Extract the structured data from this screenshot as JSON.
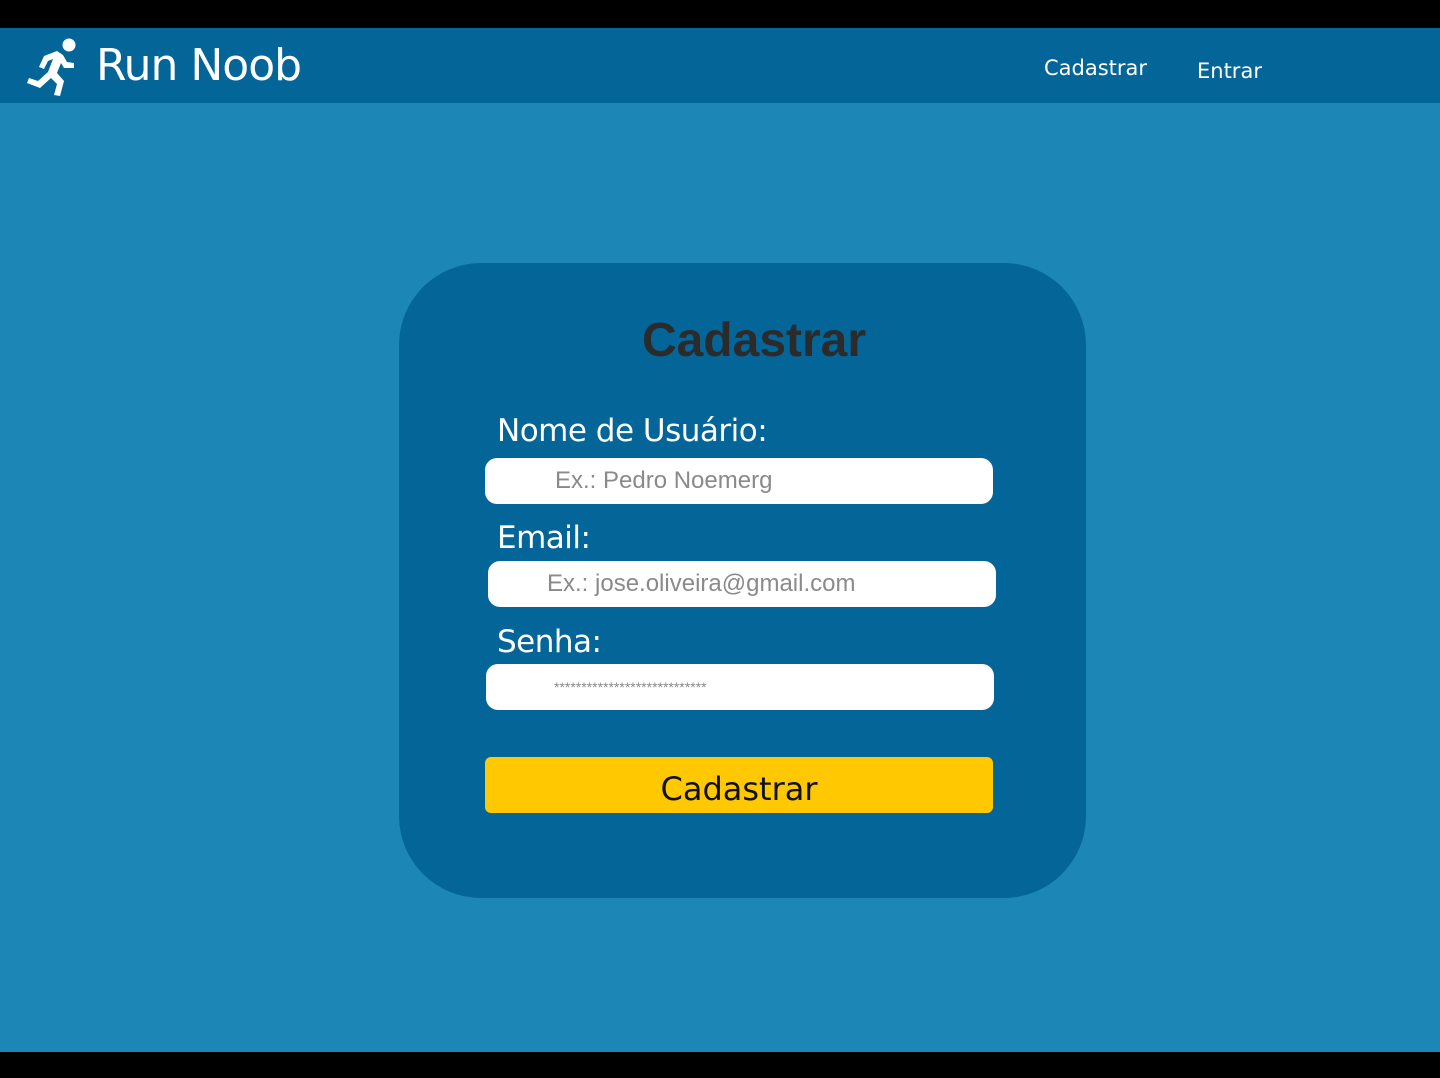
{
  "navbar": {
    "brand_name": "Run Noob",
    "brand_icon": "running-person-icon",
    "links": [
      {
        "label": "Cadastrar"
      },
      {
        "label": "Entrar"
      }
    ]
  },
  "form": {
    "title": "Cadastrar",
    "fields": [
      {
        "label": "Nome de Usuário:",
        "placeholder": "Ex.: Pedro Noemerg",
        "value": ""
      },
      {
        "label": "Email:",
        "placeholder": "Ex.: jose.oliveira@gmail.com",
        "value": ""
      },
      {
        "label": "Senha:",
        "placeholder": "****************************",
        "value": ""
      }
    ],
    "submit_label": "Cadastrar"
  },
  "colors": {
    "background": "#1c87b6",
    "navbar": "#046598",
    "card": "#046598",
    "button": "#ffc800",
    "title": "#2b2b2b"
  }
}
